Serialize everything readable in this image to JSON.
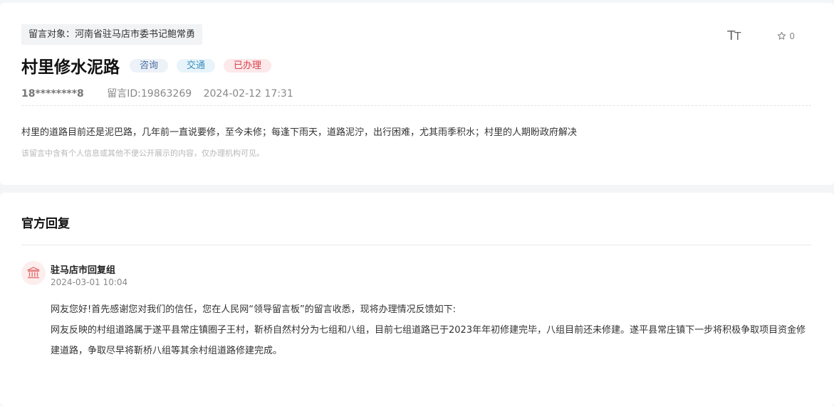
{
  "message": {
    "target_label": "留言对象：河南省驻马店市委书记鲍常勇",
    "font_size_icon": "text-size-icon",
    "favorite_count": "0",
    "title": "村里修水泥路",
    "tags": [
      "咨询",
      "交通",
      "已办理"
    ],
    "user": "18********8",
    "message_id": "留言ID:19863269",
    "datetime": "2024-02-12 17:31",
    "content": "村里的道路目前还是泥巴路，几年前一直说要修，至今未修；每逢下雨天，道路泥泞，出行困难，尤其雨季积水；村里的人期盼政府解决",
    "privacy_note": "该留言中含有个人信息或其他不便公开展示的内容，仅办理机构可见。"
  },
  "reply": {
    "heading": "官方回复",
    "org": "驻马店市回复组",
    "date": "2024-03-01 10:04",
    "para1": "网友您好!首先感谢您对我们的信任，您在人民网“领导留言板”的留言收悉，现将办理情况反馈如下:",
    "para2": "网友反映的村组道路属于遂平县常庄镇圈子王村，靳桥自然村分为七组和八组，目前七组道路已于2023年年初修建完毕，八组目前还未修建。遂平县常庄镇下一步将积极争取项目资金修建道路，争取尽早将靳桥八组等其余村组道路修建完成。"
  },
  "colors": {
    "tag_consult": "#4a6ea0",
    "tag_traffic": "#3a8fbf",
    "tag_done": "#d8414b",
    "avatar_icon": "#e57373"
  }
}
